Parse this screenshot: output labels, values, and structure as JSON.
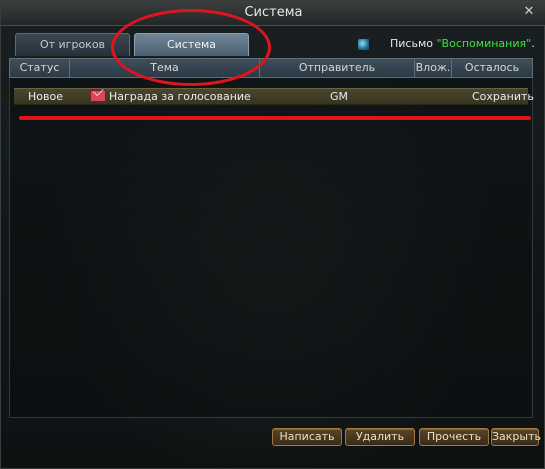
{
  "window": {
    "title": "Система",
    "close_label": "✕"
  },
  "tabs": [
    {
      "label": "От игроков",
      "active": false
    },
    {
      "label": "Система",
      "active": true
    }
  ],
  "letter_info": {
    "prefix": "Письмо ",
    "name": "\"Воспоминания\"",
    "suffix": "."
  },
  "columns": [
    "Статус",
    "Тема",
    "Отправитель",
    "Влож.",
    "Осталось"
  ],
  "rows": [
    {
      "status": "Новое",
      "icon": "envelope-icon",
      "subject": "Награда за голосование",
      "sender": "GM",
      "attachment": "",
      "remaining": "Сохранить"
    }
  ],
  "buttons": {
    "write": "Написать",
    "delete": "Удалить",
    "read": "Прочесть",
    "close": "Закрыть"
  },
  "colors": {
    "highlight_name": "#3fe03f",
    "annotation_red": "#e0141b",
    "button_border": "#a07a3c"
  }
}
